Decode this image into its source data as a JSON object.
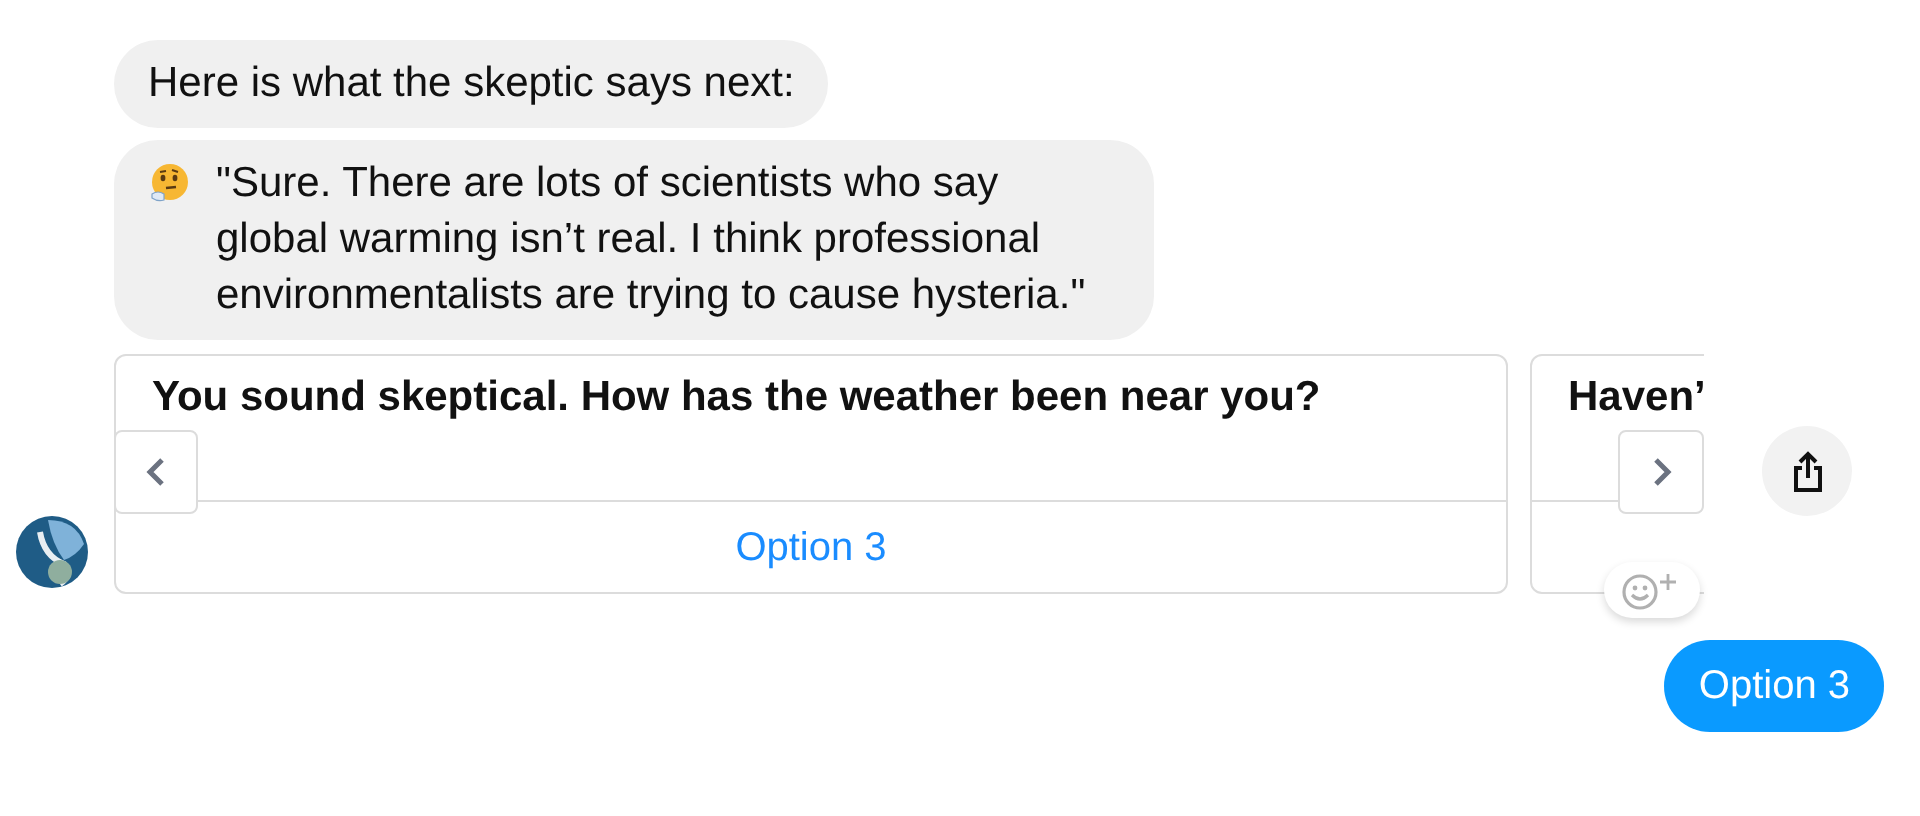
{
  "messages": [
    {
      "kind": "text",
      "text": "Here is what the skeptic says next:"
    },
    {
      "kind": "emoji_text",
      "text": "\"Sure. There are lots of scientists who say global warming isn’t real. I think professional environmentalists are trying to cause hysteria.\""
    }
  ],
  "carousel": {
    "cards": [
      {
        "title": "You sound skeptical. How has the weather been near you?",
        "option": "Option 3"
      },
      {
        "title": "Haven’"
      }
    ]
  },
  "reply": {
    "text": "Option 3"
  }
}
